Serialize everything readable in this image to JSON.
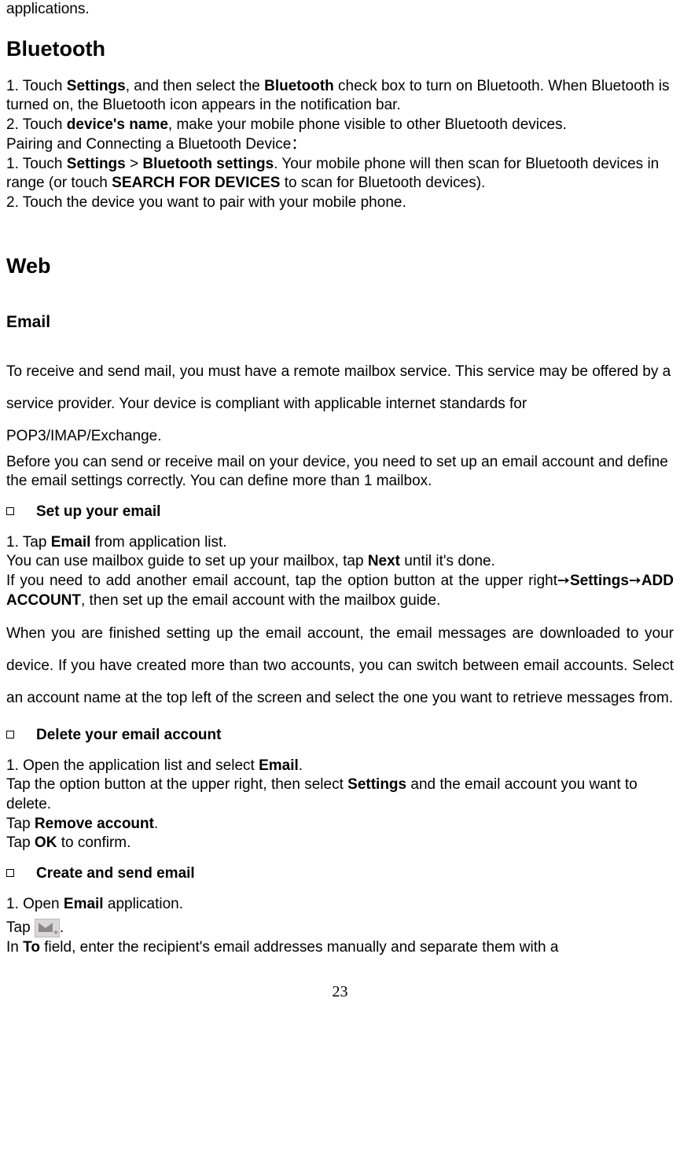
{
  "top_line": "applications.",
  "bluetooth": {
    "heading": "Bluetooth",
    "p1a": "1. Touch ",
    "p1b": "Settings",
    "p1c": ", and then select the ",
    "p1d": "Bluetooth",
    "p1e": " check box to turn on Bluetooth. When Bluetooth is turned on, the Bluetooth icon appears in the notification bar.",
    "p2a": "2. Touch ",
    "p2b": "device's name",
    "p2c": ", make your mobile phone visible to other Bluetooth devices.",
    "p3": "Pairing and Connecting a Bluetooth Device：",
    "p4a": "1. Touch ",
    "p4b": "Settings",
    "p4c": " > ",
    "p4d": "Bluetooth settings",
    "p4e": ". Your mobile phone will then scan for Bluetooth devices in range (or touch ",
    "p4f": "SEARCH FOR DEVICES",
    "p4g": " to scan for Bluetooth devices).",
    "p5": "2. Touch the device you want to pair with your mobile phone."
  },
  "web": {
    "heading": "Web"
  },
  "email": {
    "heading": "Email",
    "intro": "To receive and send mail, you must have a remote mailbox service. This service may be offered by a service provider. Your device is compliant with applicable internet standards for POP3/IMAP/Exchange.",
    "before": "Before you can send or receive mail on your device, you need to set up an email account and define the email settings correctly. You can define more than 1 mailbox.",
    "setup": {
      "title": "Set up your email",
      "s1a": "1.   Tap ",
      "s1b": "Email",
      "s1c": " from application list.",
      "s2a": "You can use mailbox guide to set up your mailbox, tap ",
      "s2b": "Next",
      "s2c": " until it's done.",
      "s3a": "If you need to add another email account, tap the option button at the upper right",
      "s3arrow1": "➙",
      "s3b": "Settings",
      "s3arrow2": "➙",
      "s3c": "ADD ACCOUNT",
      "s3d": ", then set up the email account with the mailbox guide.",
      "s4": "When you are finished setting up the email account, the email messages are downloaded to your device. If you have created more than two accounts, you can switch between email accounts. Select an account name at the top left of the screen and select the one you want to retrieve messages from."
    },
    "delete": {
      "title": "Delete your email account",
      "d1a": "1.   Open the application list and select ",
      "d1b": "Email",
      "d1c": ".",
      "d2a": "Tap the option button at the upper right, then select ",
      "d2b": "Settings",
      "d2c": " and the email account you want to delete.",
      "d3a": "Tap ",
      "d3b": "Remove account",
      "d3c": ".",
      "d4a": "Tap ",
      "d4b": "OK",
      "d4c": " to confirm."
    },
    "create": {
      "title": "Create and send email",
      "c1a": "1.   Open ",
      "c1b": "Email",
      "c1c": " application.",
      "c2a": "Tap ",
      "c2b": ".",
      "c3a": "In ",
      "c3b": "To",
      "c3c": " field, enter the recipient's email addresses manually and separate them with a"
    }
  },
  "page_number": "23"
}
